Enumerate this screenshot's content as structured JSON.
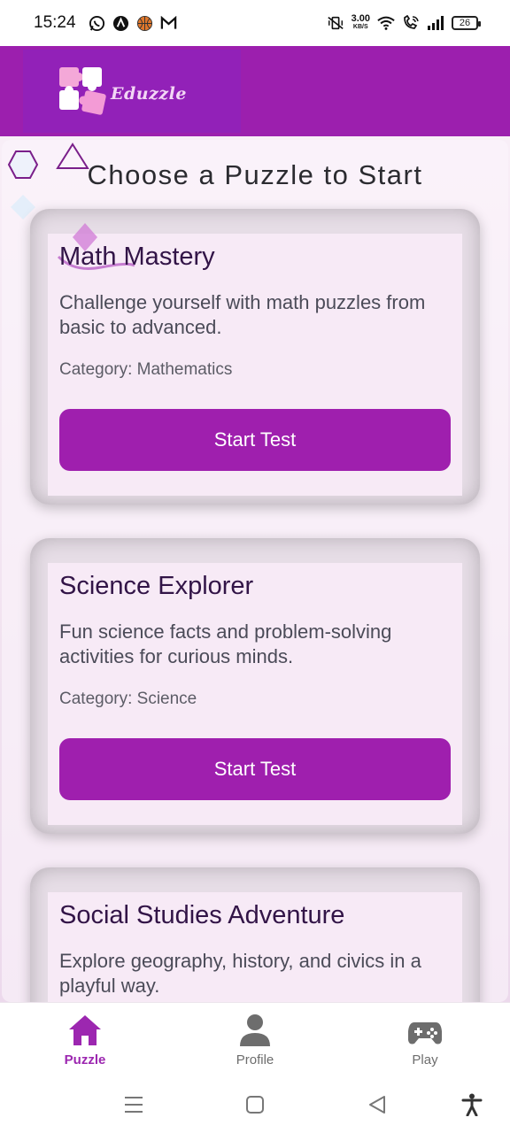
{
  "status_bar": {
    "time": "15:24",
    "net_speed_value": "3.00",
    "net_speed_unit": "KB/S",
    "battery": "26",
    "icons": [
      "whatsapp-icon",
      "a-circle-icon",
      "basketball-icon",
      "gmail-icon",
      "vibrate-mute-icon",
      "wifi-icon",
      "wifi-call-icon",
      "signal-icon",
      "battery-icon"
    ]
  },
  "header": {
    "logo_text": "Eduzzle",
    "logo_icon": "puzzle-icon"
  },
  "main": {
    "title": "Choose a Puzzle to Start",
    "cards": [
      {
        "title": "Math Mastery",
        "description": "Challenge yourself with math puzzles from basic to advanced.",
        "category": "Category: Mathematics",
        "button_label": "Start Test"
      },
      {
        "title": "Science Explorer",
        "description": "Fun science facts and problem-solving activities for curious minds.",
        "category": "Category: Science",
        "button_label": "Start Test"
      },
      {
        "title": "Social Studies Adventure",
        "description": "Explore geography, history, and civics in a playful way."
      }
    ]
  },
  "bottom_nav": {
    "items": [
      {
        "label": "Puzzle",
        "icon": "home-icon",
        "active": true
      },
      {
        "label": "Profile",
        "icon": "person-icon",
        "active": false
      },
      {
        "label": "Play",
        "icon": "gamepad-icon",
        "active": false
      }
    ]
  },
  "system_nav": {
    "icons": [
      "menu-icon",
      "home-square-icon",
      "back-icon",
      "accessibility-icon"
    ]
  },
  "colors": {
    "brand_purple": "#9c1fae",
    "button_purple": "#9f1fae",
    "active_nav": "#9c27b0",
    "card_title": "#321447"
  }
}
